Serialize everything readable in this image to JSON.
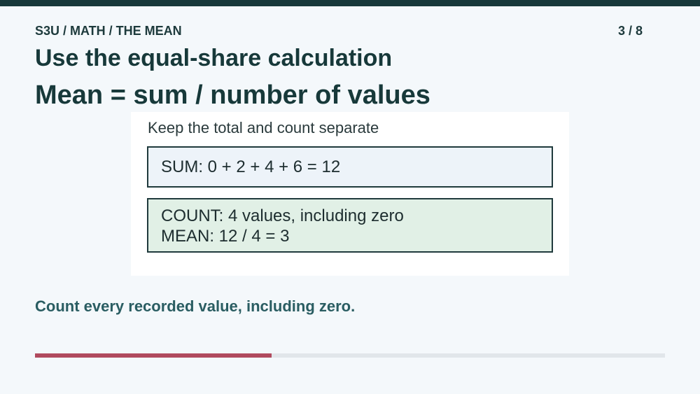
{
  "header": {
    "breadcrumb": "S3U / MATH / THE MEAN",
    "page_counter": "3 / 8"
  },
  "slide": {
    "title": "Use the equal-share calculation",
    "formula": "Mean = sum / number of values",
    "card": {
      "caption": "Keep the total and count separate",
      "sum_line": "SUM: 0 + 2 + 4 + 6 = 12",
      "count_line": "COUNT: 4 values, including zero",
      "mean_line": "MEAN: 12 / 4 = 3"
    },
    "takeaway": "Count every recorded value, including zero."
  },
  "progress": {
    "fraction": 0.375
  },
  "colors": {
    "topbar": "#17393a",
    "sum_box_bg": "#edf3f9",
    "result_box_bg": "#e1f0e6",
    "progress_fill": "#b04a5e",
    "progress_track": "#e1e6ea",
    "takeaway_text": "#2a5d62"
  }
}
